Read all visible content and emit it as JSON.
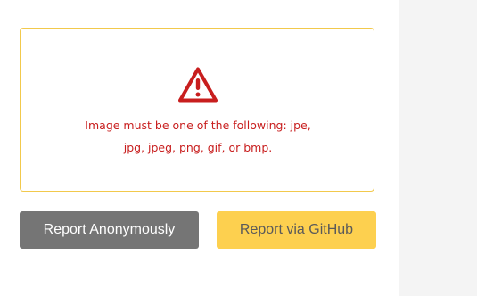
{
  "error": {
    "icon": "warning-triangle-icon",
    "color": "#c81e1e",
    "message": "Image must be one of the following: jpe, jpg, jpeg, png, gif, or bmp."
  },
  "dropzone": {
    "border_color": "#f2c94c"
  },
  "buttons": {
    "report_anonymously": "Report Anonymously",
    "report_github": "Report via GitHub"
  },
  "colors": {
    "anon_button_bg": "#757575",
    "github_button_bg": "#fdd04f",
    "side_panel_bg": "#f4f4f4"
  }
}
